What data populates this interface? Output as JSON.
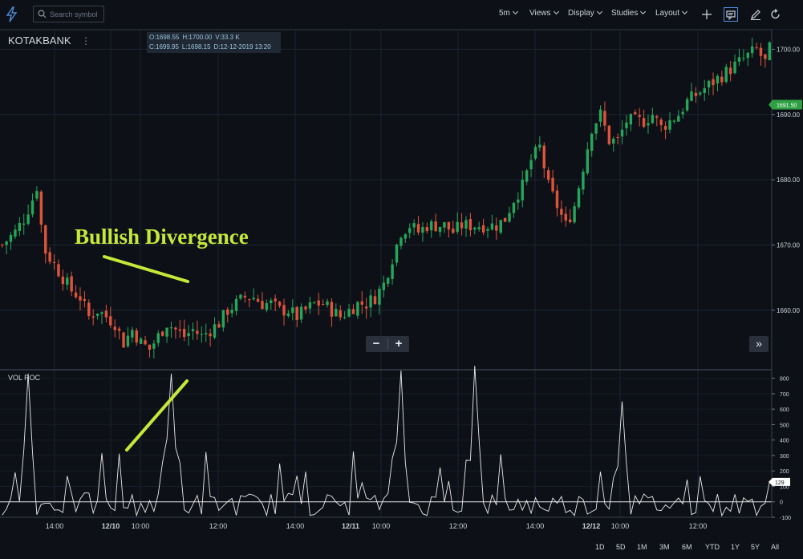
{
  "toolbar": {
    "search_placeholder": "Search symbol",
    "interval": "5m",
    "menus": [
      "Views",
      "Display",
      "Studies",
      "Layout"
    ]
  },
  "symbol": {
    "name": "KOTAKBANK",
    "menu_glyph": "⋮"
  },
  "ohlc": {
    "open": "O:1698.55",
    "high": "H:1700.00",
    "volume": "V:33.3 K",
    "close": "C:1699.95",
    "low": "L:1698.15",
    "date": "D:12-12-2019 13:20"
  },
  "zoom": {
    "minus": "−",
    "plus": "+"
  },
  "scroll_right": "»",
  "indicator": {
    "label": "VOL ROC"
  },
  "annotation": {
    "text": "Bullish Divergence",
    "color": "#c6e83a"
  },
  "colors": {
    "up": "#26a65b",
    "down": "#e0533b",
    "last_price_badge": "#2ea043",
    "line": "#e8e8e8",
    "annotation": "#c6e83a"
  },
  "price_axis": {
    "ticks": [
      "1700.00",
      "1690.00",
      "1680.00",
      "1670.00",
      "1660.00"
    ],
    "last_price": "1691.50"
  },
  "vol_axis": {
    "ticks": [
      "800",
      "700",
      "600",
      "500",
      "400",
      "300",
      "200",
      "100",
      "0",
      "-100"
    ],
    "last_value": "129"
  },
  "time_axis": {
    "labels": [
      "14:00",
      "12/10",
      "10:00",
      "12:00",
      "14:00",
      "12/11",
      "10:00",
      "12:00",
      "14:00",
      "12/12",
      "10:00",
      "12:00"
    ]
  },
  "ranges": [
    "1D",
    "5D",
    "1M",
    "3M",
    "6M",
    "YTD",
    "1Y",
    "5Y",
    "All"
  ],
  "chart_data": [
    {
      "type": "candlestick",
      "title": "KOTAKBANK",
      "ylim": [
        1651,
        1703
      ],
      "y_ticks": [
        1660,
        1670,
        1680,
        1690,
        1700
      ],
      "close_path": [
        [
          0,
          1670
        ],
        [
          3,
          1672
        ],
        [
          5,
          1674
        ],
        [
          7,
          1677
        ],
        [
          8,
          1679
        ],
        [
          9,
          1673
        ],
        [
          10,
          1669
        ],
        [
          12,
          1667
        ],
        [
          14,
          1665
        ],
        [
          16,
          1663
        ],
        [
          18,
          1662
        ],
        [
          20,
          1659
        ],
        [
          22,
          1660
        ],
        [
          24,
          1659
        ],
        [
          26,
          1658
        ],
        [
          28,
          1655
        ],
        [
          30,
          1657
        ],
        [
          32,
          1655
        ],
        [
          34,
          1654
        ],
        [
          36,
          1656
        ],
        [
          38,
          1658
        ],
        [
          40,
          1657
        ],
        [
          42,
          1656
        ],
        [
          44,
          1657
        ],
        [
          46,
          1656
        ],
        [
          48,
          1657
        ],
        [
          50,
          1658
        ],
        [
          52,
          1660
        ],
        [
          54,
          1661
        ],
        [
          56,
          1662
        ],
        [
          58,
          1662
        ],
        [
          60,
          1661
        ],
        [
          62,
          1661
        ],
        [
          64,
          1660
        ],
        [
          66,
          1660
        ],
        [
          68,
          1659
        ],
        [
          70,
          1660
        ],
        [
          72,
          1661
        ],
        [
          74,
          1661
        ],
        [
          76,
          1660
        ],
        [
          78,
          1659
        ],
        [
          80,
          1660
        ],
        [
          82,
          1661
        ],
        [
          84,
          1661
        ],
        [
          86,
          1662
        ],
        [
          88,
          1664
        ],
        [
          90,
          1668
        ],
        [
          92,
          1672
        ],
        [
          94,
          1673
        ],
        [
          96,
          1672
        ],
        [
          98,
          1673
        ],
        [
          100,
          1673
        ],
        [
          102,
          1673
        ],
        [
          104,
          1672
        ],
        [
          106,
          1673
        ],
        [
          108,
          1673
        ],
        [
          110,
          1673
        ],
        [
          112,
          1673
        ],
        [
          114,
          1673
        ],
        [
          116,
          1674
        ],
        [
          118,
          1677
        ],
        [
          120,
          1679
        ],
        [
          122,
          1683
        ],
        [
          124,
          1685
        ],
        [
          126,
          1679
        ],
        [
          128,
          1676
        ],
        [
          130,
          1673
        ],
        [
          132,
          1676
        ],
        [
          134,
          1682
        ],
        [
          136,
          1688
        ],
        [
          138,
          1690
        ],
        [
          140,
          1686
        ],
        [
          142,
          1686
        ],
        [
          144,
          1689
        ],
        [
          146,
          1689
        ],
        [
          148,
          1689
        ],
        [
          150,
          1690
        ],
        [
          152,
          1688
        ],
        [
          154,
          1689
        ],
        [
          156,
          1690
        ],
        [
          158,
          1692
        ],
        [
          160,
          1693
        ],
        [
          162,
          1694
        ],
        [
          164,
          1695
        ],
        [
          166,
          1696
        ],
        [
          168,
          1697
        ],
        [
          170,
          1698
        ],
        [
          172,
          1699
        ],
        [
          174,
          1700
        ],
        [
          176,
          1698
        ],
        [
          177,
          1700
        ]
      ],
      "extremes": {
        "early_low": 1652,
        "early_high": 1679,
        "later_high": 1703,
        "last": 1691.5
      }
    },
    {
      "type": "line",
      "title": "VOL ROC",
      "ylim": [
        -100,
        850
      ],
      "y_ticks": [
        -100,
        0,
        100,
        200,
        300,
        400,
        500,
        600,
        700,
        800
      ],
      "last": 129,
      "peaks": [
        [
          6,
          830
        ],
        [
          39,
          830
        ],
        [
          92,
          850
        ],
        [
          109,
          880
        ],
        [
          143,
          650
        ]
      ]
    }
  ]
}
